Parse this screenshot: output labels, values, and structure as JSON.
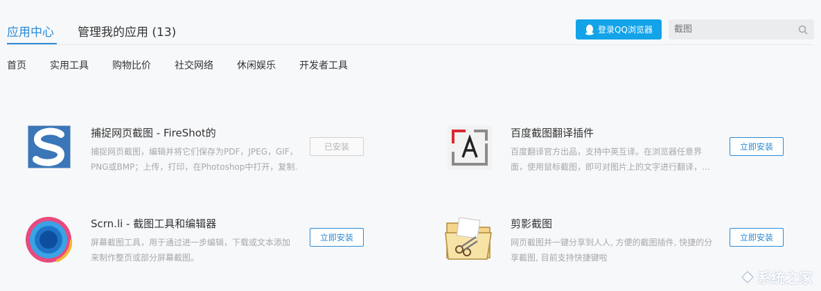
{
  "header": {
    "tab_app_center": "应用中心",
    "tab_manage": "管理我的应用 (13)",
    "login_label": "登录QQ浏览器",
    "search_placeholder": "截图"
  },
  "categories": [
    "首页",
    "实用工具",
    "购物比价",
    "社交网络",
    "休闲娱乐",
    "开发者工具"
  ],
  "apps": [
    {
      "name": "捕捉网页截图 - FireShot的",
      "desc_line1": "捕捉网页截图，编辑并将它们保存为PDF，JPEG，GIF，",
      "desc_line2": "PNG或BMP；上传，打印，在Photoshop中打开，复制…",
      "action": "已安装"
    },
    {
      "name": "百度截图翻译插件",
      "desc_line1": "百度翻译官方出品，支持中英互译。在浏览器任意界",
      "desc_line2": "面，使用鼠标截图，即可对图片上的文字进行翻译，…",
      "action": "立即安装"
    },
    {
      "name": "Scrn.li - 截图工具和编辑器",
      "desc_line1": "屏幕截图工具，用于通过进一步编辑，下载或文本添加",
      "desc_line2": "来制作整页或部分屏幕截图。",
      "action": "立即安装"
    },
    {
      "name": "剪影截图",
      "desc_line1": "网页截图并一键分享到人人, 方便的截图插件, 快捷的分",
      "desc_line2": "享截图, 目前支持快捷键啦",
      "action": "立即安装"
    }
  ],
  "watermark": "系统之家",
  "colors": {
    "accent": "#2a8ad4",
    "login_bg": "#12a3e8"
  }
}
